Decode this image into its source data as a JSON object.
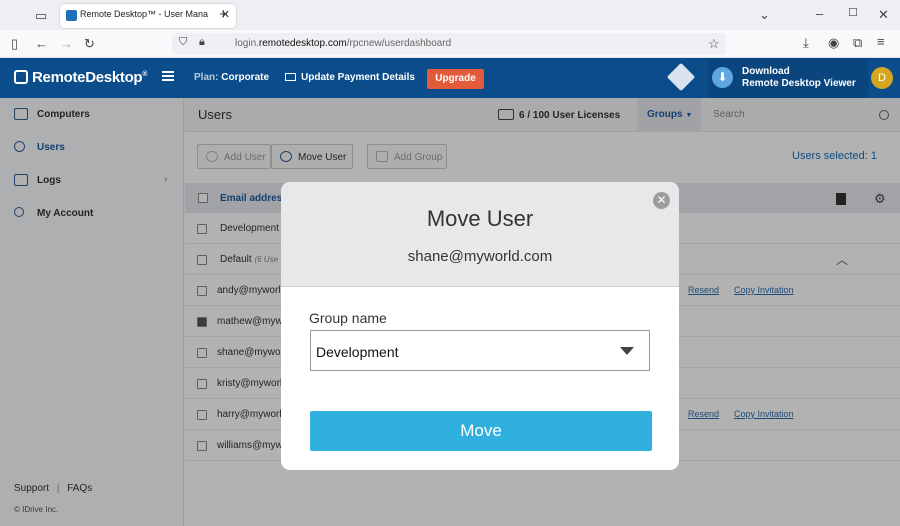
{
  "browser": {
    "tab_title": "Remote Desktop™ - User Mana",
    "tab_close": "✕",
    "url_prefix": "login.",
    "url_domain": "remotedesktop.com",
    "url_path": "/rpcnew/userdashboard",
    "new_tab": "+"
  },
  "header": {
    "logo": "RemoteDesktop",
    "logo_tm": "®",
    "plan_label": "Plan:",
    "plan_value": "Corporate",
    "update_payment": "Update Payment Details",
    "upgrade": "Upgrade",
    "download_line1": "Download",
    "download_line2": "Remote Desktop Viewer",
    "avatar_initial": "D"
  },
  "sidebar": {
    "items": [
      {
        "label": "Computers"
      },
      {
        "label": "Users"
      },
      {
        "label": "Logs"
      },
      {
        "label": "My Account"
      }
    ],
    "support": "Support",
    "faqs": "FAQs",
    "copyright": "© IDrive Inc."
  },
  "main": {
    "title": "Users",
    "licenses": "6 / 100 User Licenses",
    "groups": "Groups",
    "search_placeholder": "Search",
    "buttons": {
      "add_user": "Add User",
      "move_user": "Move User",
      "add_group": "Add Group"
    },
    "users_selected": "Users selected: 1",
    "column_email": "Email address",
    "groups_list": [
      {
        "name": "Development"
      },
      {
        "name": "Default",
        "sub": "(6 Use"
      }
    ],
    "rows": [
      {
        "email": "andy@myworl",
        "resend": "Resend",
        "copy": "Copy Invitation"
      },
      {
        "email": "mathew@mywo"
      },
      {
        "email": "shane@mywor"
      },
      {
        "email": "kristy@myworl"
      },
      {
        "email": "harry@myworl",
        "resend": "Resend",
        "copy": "Copy Invitation"
      },
      {
        "email": "williams@mywo"
      }
    ]
  },
  "modal": {
    "title": "Move User",
    "email": "shane@myworld.com",
    "group_label": "Group name",
    "group_value": "Development",
    "move_button": "Move",
    "close": "✕"
  },
  "colors": {
    "header_bg": "#0b4c8a",
    "upgrade_bg": "#e45b3c",
    "move_button_bg": "#2fb0df",
    "link": "#2a6db0"
  }
}
